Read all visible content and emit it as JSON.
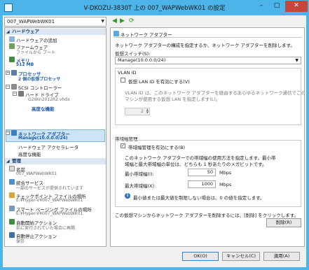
{
  "window": {
    "title": "V-DKOZU-3830T 上の 007_WAPWebWK01 の設定",
    "minimize": "–",
    "maximize": "□",
    "close": "✕"
  },
  "vm_selector": {
    "value": "007_WAPWebWK01"
  },
  "nav": {
    "back": "◀",
    "forward": "▶",
    "refresh": "⟳"
  },
  "hardware": {
    "header": "ハードウェア",
    "items": [
      {
        "label": "ハードウェアの追加"
      },
      {
        "label": "ファームウェア",
        "sub": "ファイルから ブート"
      },
      {
        "label": "メモリ",
        "sub": "512 MB"
      },
      {
        "label": "プロセッサ",
        "sub": "2 個の仮想プロセッサ"
      },
      {
        "label": "SCSI コントローラー"
      },
      {
        "label": "ハード ドライブ",
        "sub": "G2Win2012R2.vhdx"
      },
      {
        "label": "高度な機能"
      },
      {
        "label": "ネットワーク アダプター",
        "sub": "Manage(10.0.0.0/24)"
      },
      {
        "label": "ハードウェア アクセラレータ"
      },
      {
        "label": "高度な機能"
      }
    ]
  },
  "management": {
    "header": "管理",
    "items": [
      {
        "label": "名前",
        "sub": "007_WAPWebWK01"
      },
      {
        "label": "統合サービス",
        "sub": "一部のサービスが提供されています"
      },
      {
        "label": "チェックポイント ファイルの場所",
        "sub": "E:¥Hyper-V¥007_WAPWebWK01"
      },
      {
        "label": "スマート ページング ファイルの場所",
        "sub": "E:¥Hyper-V¥007_WAPWebWK01"
      },
      {
        "label": "自動開始アクション",
        "sub": "前に実行されていた場合に再開"
      },
      {
        "label": "自動停止アクション",
        "sub": "保存"
      }
    ]
  },
  "main": {
    "title": "ネットワーク アダプター",
    "description": "ネットワーク アダプターの構成を指定するか、ネットワーク アダプターを削除します。",
    "switch_label": "仮想スイッチ(S):",
    "switch_value": "Manage(10.0.0.0/24)",
    "vlan": {
      "header": "VLAN ID",
      "checkbox_label": "仮想 LAN ID を有効にする(V)",
      "description_line1": "VLAN ID は、このネットワーク アダプターを経由するあらゆるネットワーク通信でこの仮想",
      "description_line2": "マシンが使用する仮想 LAN を指定します(L)。",
      "value": "2"
    },
    "bandwidth": {
      "header": "帯域幅管理",
      "checkbox_label": "帯域幅管理を有効にする(B)",
      "description_line1": "このネットワーク アダプターでの帯域幅の使用方法を指定します。最小帯",
      "description_line2": "域幅と最大帯域幅の単位は、どちらも 1 秒あたりのメガビットです。",
      "min_label": "最小帯域幅(I):",
      "min_value": "50",
      "max_label": "最大帯域幅(X):",
      "max_value": "1000",
      "unit": "Mbps",
      "info": "最小値または最大値を制限しない場合は、0 の値を指定します。"
    },
    "remove_text": "この仮想マシンからネットワーク アダプターを削除するには、[削除] をクリックします。",
    "remove_button": "削除(R)"
  },
  "footer": {
    "ok": "OK(O)",
    "cancel": "キャンセル(C)",
    "apply": "適用(A)"
  }
}
